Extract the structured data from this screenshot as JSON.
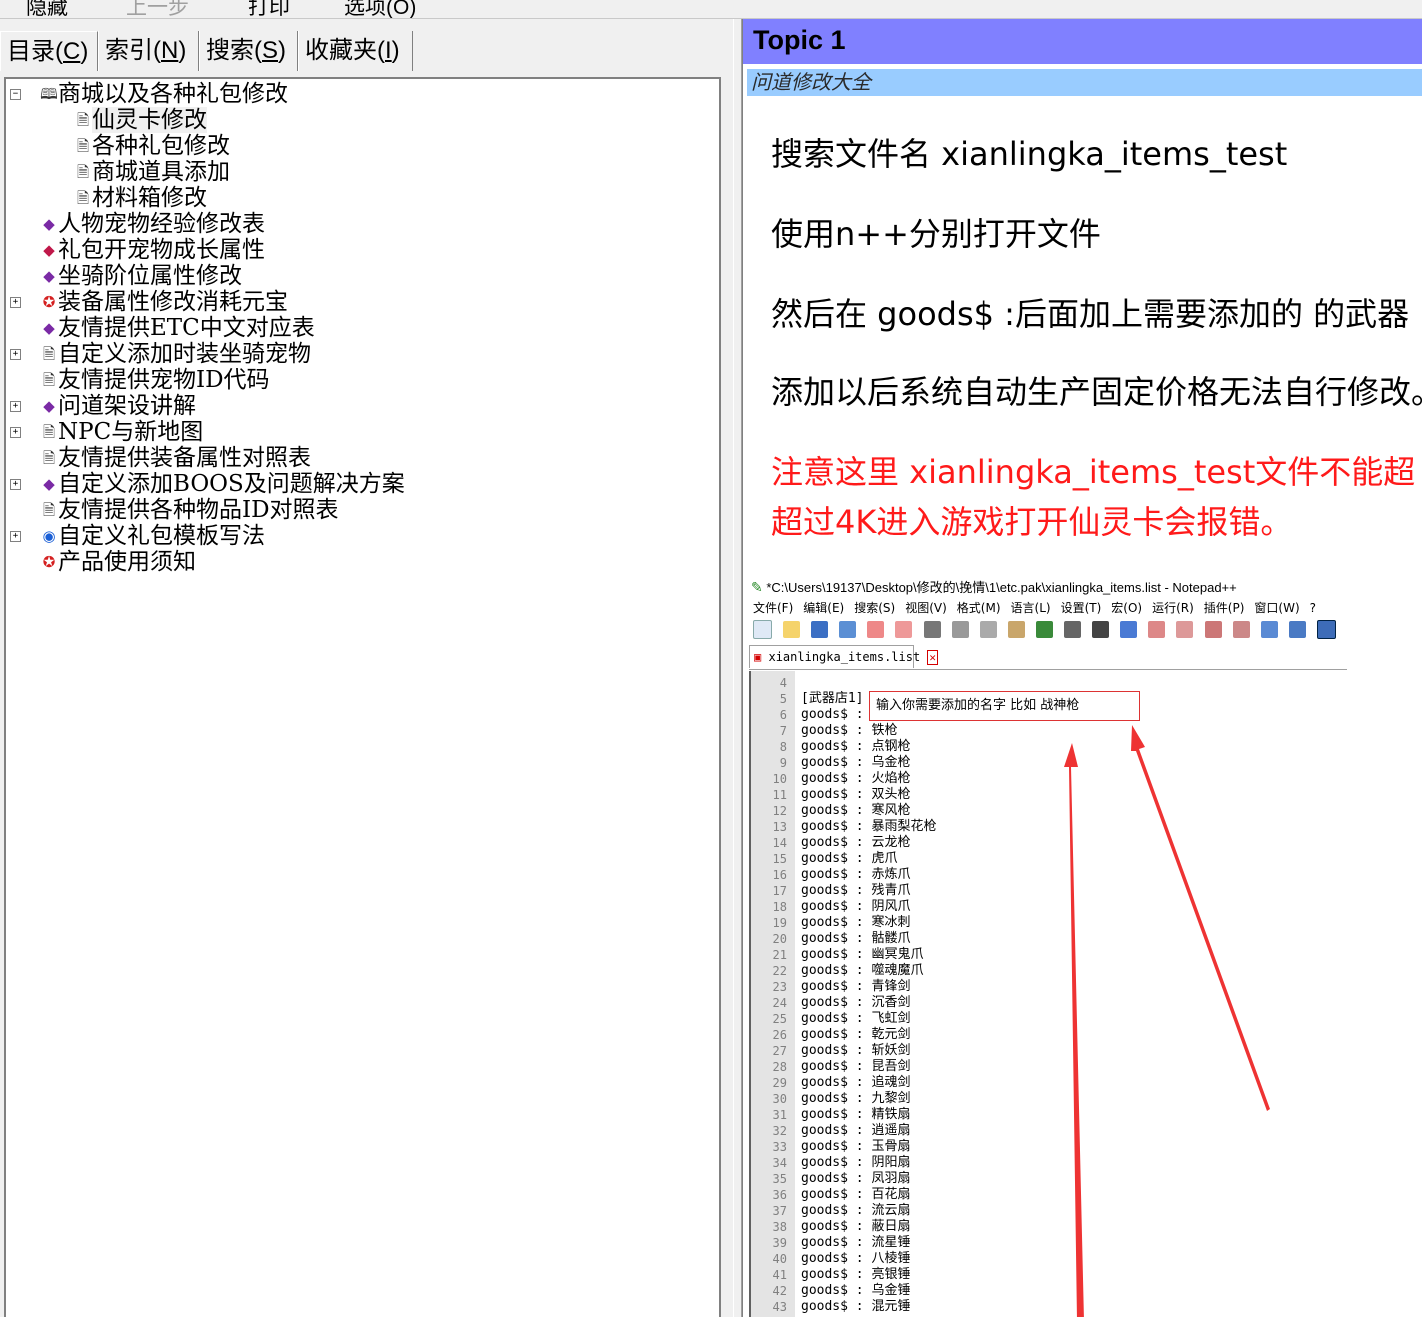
{
  "toolbar": {
    "items": [
      {
        "label": "隐藏",
        "enabled": true
      },
      {
        "label": "上一步",
        "enabled": false
      },
      {
        "label": "打印",
        "enabled": true
      },
      {
        "label": "选项(O)",
        "enabled": true
      }
    ]
  },
  "nav_tabs": [
    {
      "pre": "目录(",
      "key": "C",
      "post": ")"
    },
    {
      "pre": "索引(",
      "key": "N",
      "post": ")"
    },
    {
      "pre": "搜索(",
      "key": "S",
      "post": ")"
    },
    {
      "pre": "收藏夹(",
      "key": "I",
      "post": ")"
    }
  ],
  "tree": {
    "items": [
      {
        "label": "商城以及各种礼包修改",
        "icon": "open-book-icon",
        "expander": "⊟"
      },
      {
        "label": "仙灵卡修改",
        "icon": "page-icon"
      },
      {
        "label": "各种礼包修改",
        "icon": "page-icon"
      },
      {
        "label": "商城道具添加",
        "icon": "page-icon"
      },
      {
        "label": "材料箱修改",
        "icon": "page-icon"
      },
      {
        "label": "人物宠物经验修改表",
        "icon": "book-icon"
      },
      {
        "label": "礼包开宠物成长属性",
        "icon": "book-red-icon"
      },
      {
        "label": "坐骑阶位属性修改",
        "icon": "book-icon"
      },
      {
        "label": "装备属性修改消耗元宝",
        "icon": "special-icon",
        "expander": "⊞"
      },
      {
        "label": "友情提供ETC中文对应表",
        "icon": "book-icon"
      },
      {
        "label": "自定义添加时装坐骑宠物",
        "icon": "page-icon",
        "expander": "⊞"
      },
      {
        "label": "友情提供宠物ID代码",
        "icon": "page-icon"
      },
      {
        "label": "问道架设讲解",
        "icon": "book-icon",
        "expander": "⊞"
      },
      {
        "label": "NPC与新地图",
        "icon": "page-icon",
        "expander": "⊞"
      },
      {
        "label": "友情提供装备属性对照表",
        "icon": "page-icon"
      },
      {
        "label": "自定义添加BOOS及问题解决方案",
        "icon": "book-icon",
        "expander": "⊞"
      },
      {
        "label": "友情提供各种物品ID对照表",
        "icon": "page-icon"
      },
      {
        "label": "自定义礼包模板写法",
        "icon": "globe-icon",
        "expander": "⊞"
      },
      {
        "label": "产品使用须知",
        "icon": "special-icon"
      }
    ]
  },
  "topic": {
    "title": "Topic 1",
    "subtitle": "问道修改大全",
    "paragraphs": [
      "搜索文件名  xianlingka_items_test",
      "使用n++分别打开文件",
      "然后在  goods$ :后面加上需要添加的  的武器",
      "添加以后系统自动生产固定价格无法自行修改。"
    ],
    "warning_line1": "注意这里  xianlingka_items_test文件不能超",
    "warning_line2": "超过4K进入游戏打开仙灵卡会报错。"
  },
  "notepad": {
    "title": "*C:\\Users\\19137\\Desktop\\修改的\\挽情\\1\\etc.pak\\xianlingka_items.list - Notepad++",
    "menu": [
      "文件(F)",
      "编辑(E)",
      "搜索(S)",
      "视图(V)",
      "格式(M)",
      "语言(L)",
      "设置(T)",
      "宏(O)",
      "运行(R)",
      "插件(P)",
      "窗口(W)",
      "?"
    ],
    "tab_name": "xianlingka_items.list",
    "annotation": "输入你需要添加的名字  比如  战神枪",
    "lines": [
      {
        "n": "4",
        "text": ""
      },
      {
        "n": "5",
        "text": "[武器店1]"
      },
      {
        "n": "6",
        "text": "goods$ :"
      },
      {
        "n": "7",
        "text": "goods$ : 铁枪"
      },
      {
        "n": "8",
        "text": "goods$ : 点钢枪"
      },
      {
        "n": "9",
        "text": "goods$ : 乌金枪"
      },
      {
        "n": "10",
        "text": "goods$ : 火焰枪"
      },
      {
        "n": "11",
        "text": "goods$ : 双头枪"
      },
      {
        "n": "12",
        "text": "goods$ : 寒风枪"
      },
      {
        "n": "13",
        "text": "goods$ : 暴雨梨花枪"
      },
      {
        "n": "14",
        "text": "goods$ : 云龙枪"
      },
      {
        "n": "15",
        "text": "goods$ : 虎爪"
      },
      {
        "n": "16",
        "text": "goods$ : 赤炼爪"
      },
      {
        "n": "17",
        "text": "goods$ : 残青爪"
      },
      {
        "n": "18",
        "text": "goods$ : 阴风爪"
      },
      {
        "n": "19",
        "text": "goods$ : 寒冰刺"
      },
      {
        "n": "20",
        "text": "goods$ : 骷髅爪"
      },
      {
        "n": "21",
        "text": "goods$ : 幽冥鬼爪"
      },
      {
        "n": "22",
        "text": "goods$ : 噬魂魔爪"
      },
      {
        "n": "23",
        "text": "goods$ : 青锋剑"
      },
      {
        "n": "24",
        "text": "goods$ : 沉香剑"
      },
      {
        "n": "25",
        "text": "goods$ : 飞虹剑"
      },
      {
        "n": "26",
        "text": "goods$ : 乾元剑"
      },
      {
        "n": "27",
        "text": "goods$ : 斩妖剑"
      },
      {
        "n": "28",
        "text": "goods$ : 昆吾剑"
      },
      {
        "n": "29",
        "text": "goods$ : 追魂剑"
      },
      {
        "n": "30",
        "text": "goods$ : 九黎剑"
      },
      {
        "n": "31",
        "text": "goods$ : 精铁扇"
      },
      {
        "n": "32",
        "text": "goods$ : 逍遥扇"
      },
      {
        "n": "33",
        "text": "goods$ : 玉骨扇"
      },
      {
        "n": "34",
        "text": "goods$ : 阴阳扇"
      },
      {
        "n": "35",
        "text": "goods$ : 凤羽扇"
      },
      {
        "n": "36",
        "text": "goods$ : 百花扇"
      },
      {
        "n": "37",
        "text": "goods$ : 流云扇"
      },
      {
        "n": "38",
        "text": "goods$ : 蔽日扇"
      },
      {
        "n": "39",
        "text": "goods$ : 流星锤"
      },
      {
        "n": "40",
        "text": "goods$ : 八棱锤"
      },
      {
        "n": "41",
        "text": "goods$ : 亮银锤"
      },
      {
        "n": "42",
        "text": "goods$ : 乌金锤"
      },
      {
        "n": "43",
        "text": "goods$ : 混元锤"
      }
    ]
  },
  "colors": {
    "topic_header": "#8080ff",
    "topic_sub": "#99ccff",
    "warning": "#ff1a1a",
    "arrow": "#ee3333"
  }
}
